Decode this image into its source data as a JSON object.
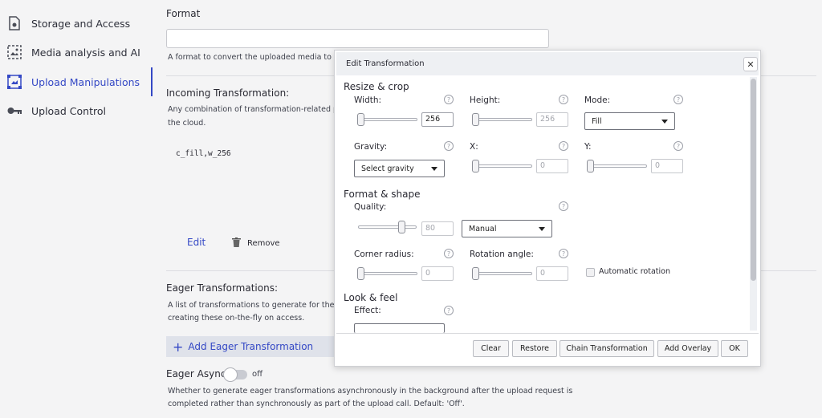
{
  "sidebar": {
    "items": [
      {
        "label": "Storage and Access",
        "icon": "storage-icon"
      },
      {
        "label": "Media analysis and AI",
        "icon": "image-analysis-icon"
      },
      {
        "label": "Upload Manipulations",
        "icon": "manipulations-icon",
        "active": true
      },
      {
        "label": "Upload Control",
        "icon": "key-icon"
      }
    ]
  },
  "main": {
    "format": {
      "label": "Format",
      "value": "",
      "help": "A format to convert the uploaded media to be"
    },
    "incoming": {
      "label": "Incoming Transformation:",
      "help_line1": "Any combination of transformation-related pa",
      "help_line2": "the cloud.",
      "code": "c_fill,w_256",
      "edit_label": "Edit",
      "remove_label": "Remove"
    },
    "eager": {
      "label": "Eager Transformations:",
      "help_line1": "A list of transformations to generate for the up",
      "help_line2": "creating these on-the-fly on access.",
      "add_label": "Add Eager Transformation"
    },
    "eager_async": {
      "label": "Eager Async:",
      "state": "off",
      "help_line1": "Whether to generate eager transformations asynchronously in the background after the upload request is",
      "help_line2": "completed rather than synchronously as part of the upload call. Default: 'Off'."
    }
  },
  "dialog": {
    "title": "Edit Transformation",
    "close_icon": "close-icon",
    "sections": {
      "resize": "Resize & crop",
      "format": "Format & shape",
      "look": "Look & feel"
    },
    "fields": {
      "width": {
        "label": "Width:",
        "value": "256"
      },
      "height": {
        "label": "Height:",
        "placeholder": "256"
      },
      "mode": {
        "label": "Mode:",
        "value": "Fill"
      },
      "gravity": {
        "label": "Gravity:",
        "value": "Select gravity"
      },
      "x": {
        "label": "X:",
        "placeholder": "0"
      },
      "y": {
        "label": "Y:",
        "placeholder": "0"
      },
      "quality": {
        "label": "Quality:",
        "placeholder": "80",
        "mode": "Manual"
      },
      "corner_radius": {
        "label": "Corner radius:",
        "placeholder": "0"
      },
      "rotation": {
        "label": "Rotation angle:",
        "placeholder": "0"
      },
      "auto_rotation": {
        "label": "Automatic rotation",
        "checked": false
      },
      "effect": {
        "label": "Effect:"
      }
    },
    "buttons": {
      "clear": "Clear",
      "restore": "Restore",
      "chain": "Chain Transformation",
      "overlay": "Add Overlay",
      "ok": "OK"
    },
    "help_glyph": "?"
  }
}
